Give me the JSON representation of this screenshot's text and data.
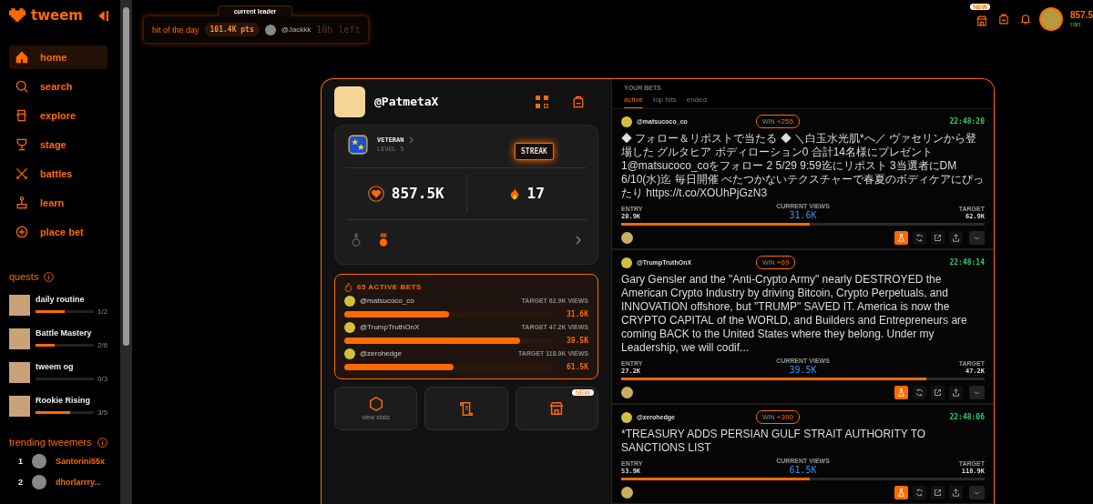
{
  "brand": {
    "name": "tweem"
  },
  "nav": [
    {
      "label": "home",
      "kind": "home",
      "selected": true
    },
    {
      "label": "search",
      "kind": "search",
      "selected": false
    },
    {
      "label": "explore",
      "kind": "explore",
      "selected": false
    },
    {
      "label": "stage",
      "kind": "stage",
      "selected": false
    },
    {
      "label": "battles",
      "kind": "battles",
      "selected": false
    },
    {
      "label": "learn",
      "kind": "learn",
      "selected": false
    },
    {
      "label": "place bet",
      "kind": "plus",
      "selected": false
    }
  ],
  "quests": {
    "title": "quests",
    "items": [
      {
        "name": "daily routine",
        "level": 0.5,
        "progress": "1/2"
      },
      {
        "name": "Battle Mastery",
        "level": 0.33,
        "progress": "2/6"
      },
      {
        "name": "tweem og",
        "level": 0,
        "progress": "0/3"
      },
      {
        "name": "Rookie Rising",
        "level": 0.6,
        "progress": "3/5"
      }
    ]
  },
  "trending": {
    "title": "trending tweemers",
    "items": [
      {
        "rank": "1",
        "name": "Santorini55x"
      },
      {
        "rank": "2",
        "name": "dhorlarrry..."
      }
    ]
  },
  "leader": {
    "tab": "current leader",
    "label": "hit of the day",
    "points": "101.4K pts",
    "user": "@Jackkk",
    "time_left": "10h left"
  },
  "top_bar": {
    "new_badge": "NEW",
    "balance": "857.5",
    "rank": "ran"
  },
  "profile": {
    "handle": "@PatmetaX",
    "rank": "VETERAN",
    "level": "LEVEL 5",
    "balance": "857.5K",
    "streak_label": "STREAK",
    "streak": "17"
  },
  "active_bets": {
    "title": "65 ACTIVE BETS",
    "items": [
      {
        "user": "@matsucoco_co",
        "target": "TARGET 62.9K VIEWS",
        "level": 0.5,
        "views": "31.6K"
      },
      {
        "user": "@TrumpTruthOnX",
        "target": "TARGET 47.2K VIEWS",
        "level": 0.84,
        "views": "39.5K"
      },
      {
        "user": "@zerohedge",
        "target": "TARGET 118.9K VIEWS",
        "level": 0.52,
        "views": "61.5K"
      }
    ]
  },
  "tiles": [
    {
      "kind": "stats",
      "label": "view stats"
    },
    {
      "kind": "scroll"
    },
    {
      "kind": "store",
      "badge": "NEW"
    }
  ],
  "your_bets": {
    "title": "YOUR BETS",
    "tabs": [
      {
        "label": "active",
        "selected": true
      },
      {
        "label": "top hits",
        "selected": false
      },
      {
        "label": "ended",
        "selected": false
      }
    ],
    "bets": [
      {
        "user": "@matsucoco_co",
        "win_label": "WIN",
        "win": "+255",
        "time": "22:48:20",
        "text": "◆ フォロー＆リポストで当たる ◆ ＼白玉水光肌*へ／ ヴァセリンから登場した グルタヒア ボディローション0 合計14名様にプレゼント 1@matsucoco_coをフォロー 2 5/29 9:59迄にリポスト 3当選者にDM 6/10(水)迄 毎日開催 べたつかないテクスチャーで春夏のボディケアにぴったり https://t.co/XOUhPjGzN3",
        "entry_label": "ENTRY",
        "entry": "20.9K",
        "current_label": "CURRENT VIEWS",
        "current": "31.6K",
        "target_label": "TARGET",
        "target": "62.9K",
        "level": 0.52
      },
      {
        "user": "@TrumpTruthOnX",
        "win_label": "WIN",
        "win": "+69",
        "time": "22:48:14",
        "text": "Gary Gensler and the \"Anti-Crypto Army\" nearly DESTROYED the American Crypto Industry by driving Bitcoin, Crypto Perpetuals, and INNOVATION offshore, but \"TRUMP\" SAVED IT. America is now the CRYPTO CAPITAL of the WORLD, and Builders and Entrepreneurs are coming BACK to the United States where they belong. Under my Leadership, we will codif...",
        "entry_label": "ENTRY",
        "entry": "27.2K",
        "current_label": "CURRENT VIEWS",
        "current": "39.5K",
        "target_label": "TARGET",
        "target": "47.2K",
        "level": 0.84
      },
      {
        "user": "@zerohedge",
        "win_label": "WIN",
        "win": "+390",
        "time": "22:48:06",
        "text": "*TREASURY ADDS PERSIAN GULF STRAIT AUTHORITY TO SANCTIONS LIST",
        "entry_label": "ENTRY",
        "entry": "53.9K",
        "current_label": "CURRENT VIEWS",
        "current": "61.5K",
        "target_label": "TARGET",
        "target": "118.9K",
        "level": 0.52
      }
    ]
  }
}
